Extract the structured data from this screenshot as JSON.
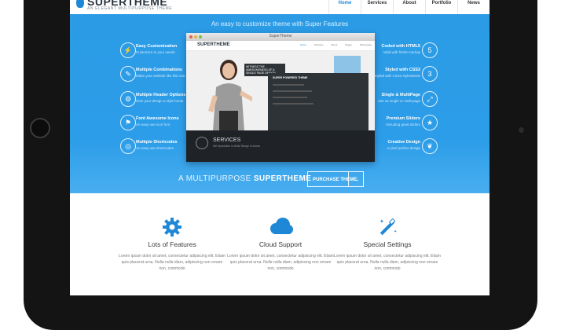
{
  "nav": {
    "logo_name": "SUPERTHEME",
    "logo_tag": "AN ELEGANT MULTIPURPOSE THEME",
    "items": [
      "Home",
      "Services",
      "About",
      "Portfolio",
      "News"
    ]
  },
  "hero": {
    "tagline": "An easy to customize theme with Super Features",
    "left_features": [
      {
        "title": "Easy Customization",
        "sub": "Customize to your needs"
      },
      {
        "title": "Multiple Combinations",
        "sub": "Make your website like this one"
      },
      {
        "title": "Multiple Header Options",
        "sub": "Give your design a style boost"
      },
      {
        "title": "Font Awesome Icons",
        "sub": "An easy use icon font"
      },
      {
        "title": "Multiple Shortcodes",
        "sub": "An easy use shortcodes"
      }
    ],
    "right_features": [
      {
        "title": "Coded with HTML5",
        "sub": "Valid with html5 markup"
      },
      {
        "title": "Styled with CSS3",
        "sub": "Styled with CSS3 stylesheets"
      },
      {
        "title": "Single & MultiPage",
        "sub": "Use as single or multi page"
      },
      {
        "title": "Premium Sliders",
        "sub": "Including great sliders"
      },
      {
        "title": "Creative Design",
        "sub": "A pixel perfect design"
      }
    ],
    "browser": {
      "title": "SuperTheme",
      "logo": "SUPERTHEME",
      "links": [
        "Home",
        "Services",
        "About",
        "Pages",
        "Shortcodes"
      ],
      "callout": "WITNESS THE AWESOMENESS OF A SINGLE PAGE DESIGN",
      "panel_title": "SUPER  POWERED THEME",
      "services_title": "SERVICES",
      "services_sub": "We Specialize in Wide Range of Areas"
    },
    "cta_prefix": "A MULTIPURPOSE ",
    "cta_bold": "SUPERTHEME",
    "button_label": "PURCHASE THEME",
    "button_arrow": "→"
  },
  "features": [
    {
      "icon": "gear-icon",
      "title": "Lots of Features",
      "text": "Lorem ipsum dolor sit amet, consectetur adipiscing elit. Etiam quis placerat urna. Nulla nulla diam, adipiscing non ornare non, commodo"
    },
    {
      "icon": "cloud-icon",
      "title": "Cloud Support",
      "text": "Lorem ipsum dolor sit amet, consectetur adipiscing elit. Etiam quis placerat urna. Nulla nulla diam, adipiscing non ornare non, commodo"
    },
    {
      "icon": "magic-wand-icon",
      "title": "Special Settings",
      "text": "Lorem ipsum dolor sit amet, consectetur adipiscing elit. Etiam quis placerat urna. Nulla nulla diam, adipiscing non ornare non, commodo"
    }
  ],
  "colors": {
    "accent": "#1e88d6",
    "hero": "#2c9de8",
    "frame": "#141414"
  }
}
